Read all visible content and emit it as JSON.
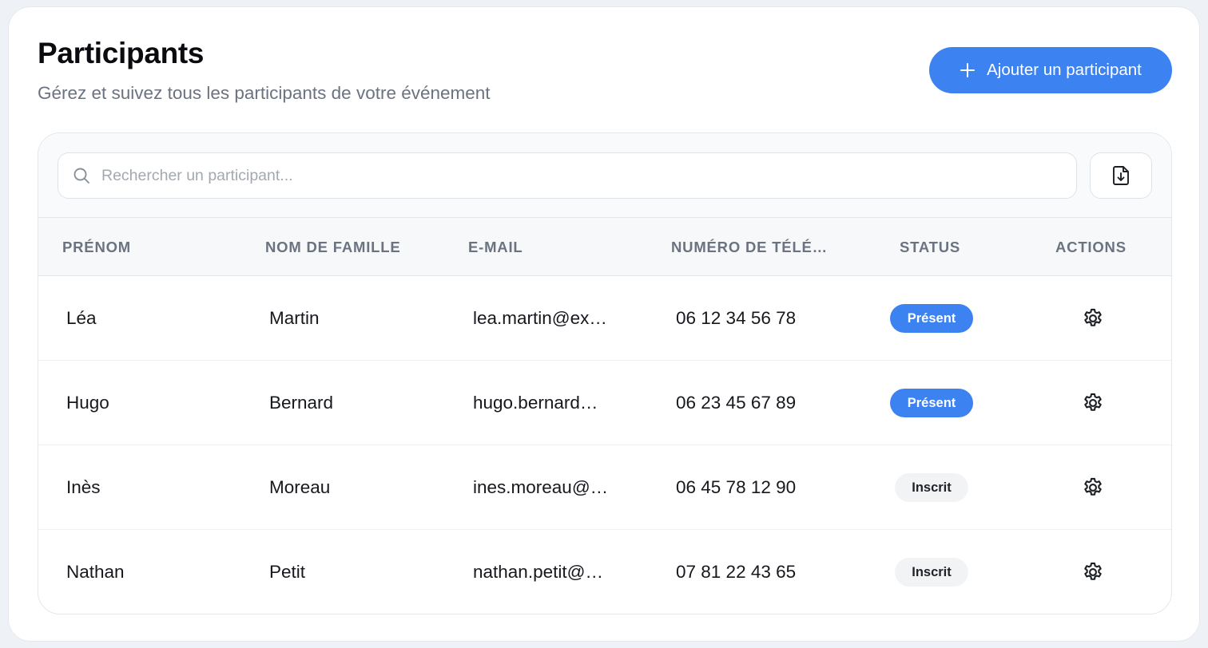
{
  "header": {
    "title": "Participants",
    "subtitle": "Gérez et suivez tous les participants de votre événement",
    "add_button_label": "Ajouter un participant"
  },
  "search": {
    "placeholder": "Rechercher un participant..."
  },
  "table": {
    "columns": [
      "PRÉNOM",
      "NOM DE FAMILLE",
      "E-MAIL",
      "NUMÉRO DE TÉLÉ…",
      "STATUS",
      "ACTIONS"
    ],
    "rows": [
      {
        "prenom": "Léa",
        "nom": "Martin",
        "email": "lea.martin@ex…",
        "phone": "06 12 34 56 78",
        "status": "Présent",
        "status_kind": "present"
      },
      {
        "prenom": "Hugo",
        "nom": "Bernard",
        "email": "hugo.bernard…",
        "phone": "06 23 45 67 89",
        "status": "Présent",
        "status_kind": "present"
      },
      {
        "prenom": "Inès",
        "nom": "Moreau",
        "email": "ines.moreau@…",
        "phone": "06 45 78 12 90",
        "status": "Inscrit",
        "status_kind": "inscrit"
      },
      {
        "prenom": "Nathan",
        "nom": "Petit",
        "email": "nathan.petit@…",
        "phone": "07 81 22 43 65",
        "status": "Inscrit",
        "status_kind": "inscrit"
      }
    ]
  },
  "icons": {
    "add": "plus-icon",
    "search": "search-icon",
    "export": "file-download-icon",
    "row_action": "gear-icon"
  },
  "colors": {
    "accent": "#3c82f0",
    "inscrit_bg": "#f2f3f5"
  }
}
